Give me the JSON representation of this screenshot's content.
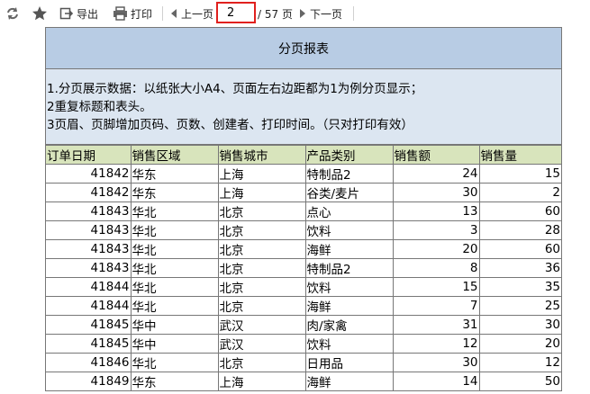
{
  "toolbar": {
    "icons": [
      "refresh-icon",
      "star-icon"
    ],
    "export_label": "导出",
    "print_label": "打印",
    "prev_label": "上一页",
    "page_value": "2",
    "total_label": "/ 57 页",
    "next_label": "下一页"
  },
  "report": {
    "title": "分页报表",
    "notes": [
      "1.分页展示数据：以纸张大小A4、页面左右边距都为1为例分页显示；",
      "2重复标题和表头。",
      "3页眉、页脚增加页码、页数、创建者、打印时间。（只对打印有效）"
    ],
    "columns": [
      "订单日期",
      "销售区域",
      "销售城市",
      "产品类别",
      "销售额",
      "销售量"
    ],
    "rows": [
      [
        "41842",
        "华东",
        "上海",
        "特制品2",
        "24",
        "15"
      ],
      [
        "41842",
        "华东",
        "上海",
        "谷类/麦片",
        "30",
        "2"
      ],
      [
        "41843",
        "华北",
        "北京",
        "点心",
        "13",
        "60"
      ],
      [
        "41843",
        "华北",
        "北京",
        "饮料",
        "3",
        "28"
      ],
      [
        "41843",
        "华北",
        "北京",
        "海鲜",
        "20",
        "60"
      ],
      [
        "41843",
        "华北",
        "北京",
        "特制品2",
        "8",
        "36"
      ],
      [
        "41844",
        "华北",
        "北京",
        "饮料",
        "15",
        "35"
      ],
      [
        "41844",
        "华北",
        "北京",
        "海鲜",
        "7",
        "25"
      ],
      [
        "41845",
        "华中",
        "武汉",
        "肉/家禽",
        "31",
        "30"
      ],
      [
        "41845",
        "华中",
        "武汉",
        "饮料",
        "12",
        "20"
      ],
      [
        "41846",
        "华北",
        "北京",
        "日用品",
        "30",
        "12"
      ],
      [
        "41849",
        "华东",
        "上海",
        "海鲜",
        "14",
        "50"
      ]
    ]
  }
}
